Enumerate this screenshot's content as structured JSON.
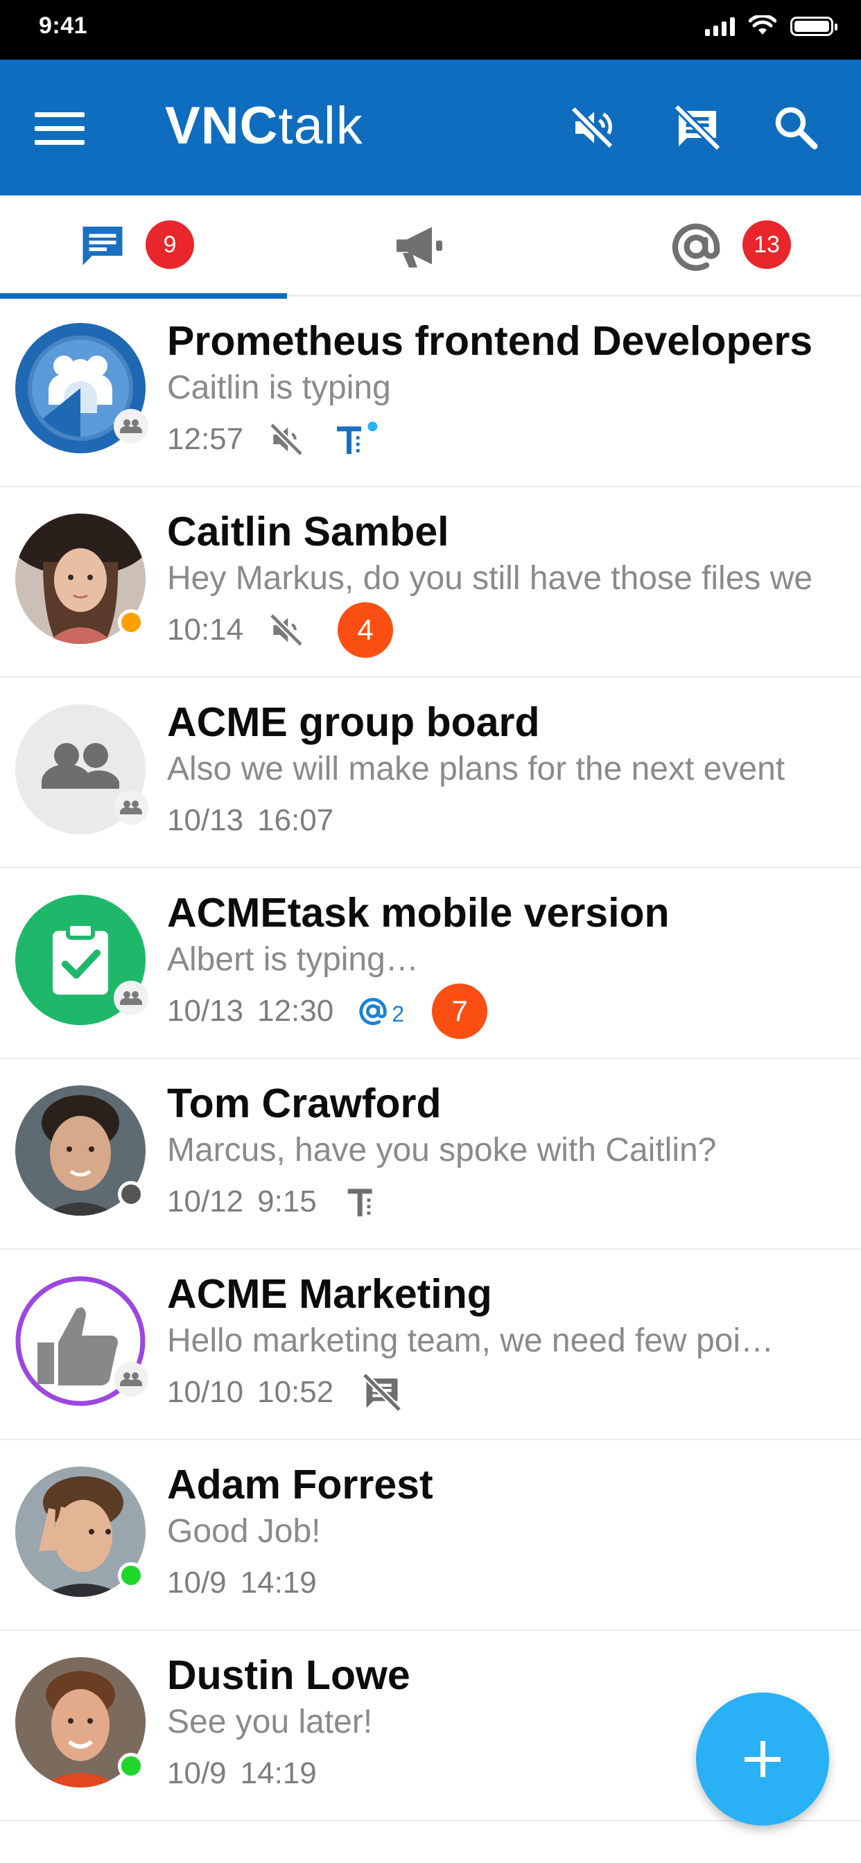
{
  "status_bar": {
    "time": "9:41"
  },
  "app_bar": {
    "brand_bold": "VNC",
    "brand_light": "talk"
  },
  "tabs": [
    {
      "name": "chats",
      "badge": "9",
      "active": true
    },
    {
      "name": "broadcast",
      "badge": "",
      "active": false
    },
    {
      "name": "mentions",
      "badge": "13",
      "active": false
    }
  ],
  "conversations": [
    {
      "title": "Prometheus frontend Developers",
      "message": "Caitlin is typing",
      "time": "12:57",
      "muted": true,
      "group": true
    },
    {
      "title": "Caitlin Sambel",
      "message": "Hey Markus, do you still have those files we",
      "time": "10:14",
      "muted": true,
      "unread": "4",
      "presence": "#ffa000"
    },
    {
      "title": "ACME group board",
      "message": "Also we will make plans for the next event",
      "date": "10/13",
      "time": "16:07",
      "group": true
    },
    {
      "title": "ACMEtask mobile version",
      "message": "Albert is typing…",
      "date": "10/13",
      "time": "12:30",
      "mention": "2",
      "unread": "7",
      "group": true
    },
    {
      "title": "Tom Crawford",
      "message": "Marcus, have you spoke with Caitlin?",
      "date": "10/12",
      "time": "9:15",
      "presence": "#555555"
    },
    {
      "title": "ACME Marketing",
      "message": "Hello marketing team, we need few poi…",
      "date": "10/10",
      "time": "10:52",
      "group": true
    },
    {
      "title": "Adam Forrest",
      "message": "Good Job!",
      "date": "10/9",
      "time": "14:19",
      "presence": "#1fd62a"
    },
    {
      "title": "Dustin Lowe",
      "message": "See you later!",
      "date": "10/9",
      "time": "14:19",
      "presence": "#1fd62a"
    }
  ],
  "colors": {
    "primary": "#0f6dbf",
    "unread": "#fb4e13",
    "badge": "#e8262b",
    "fab": "#2ab1f5"
  }
}
